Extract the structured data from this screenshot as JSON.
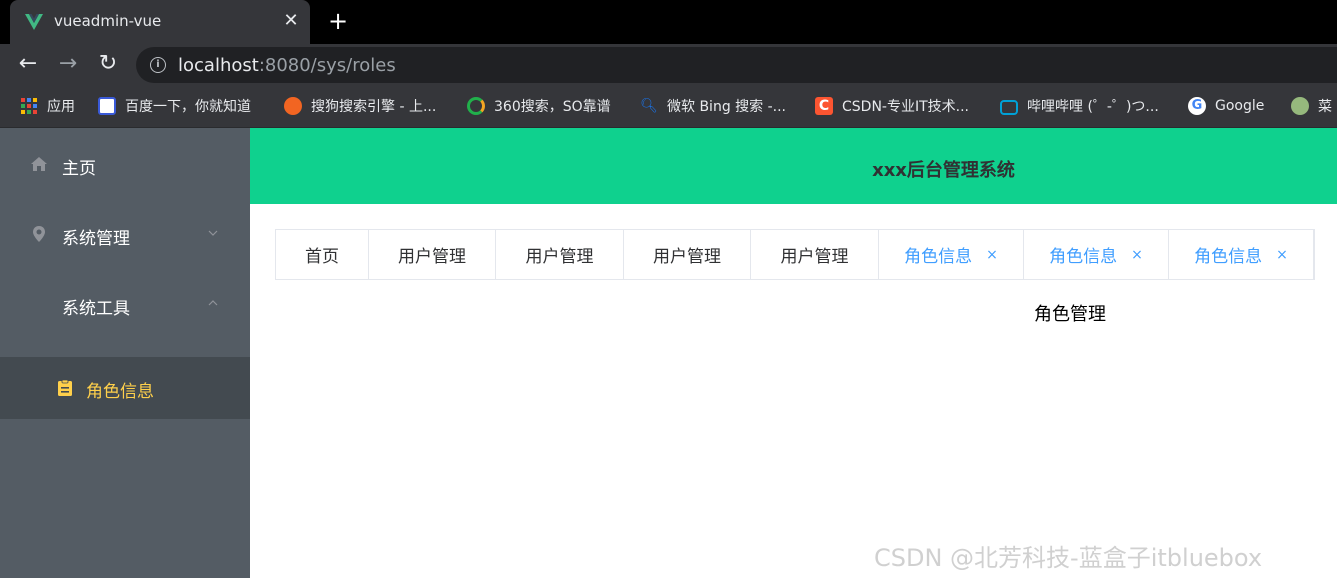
{
  "browser": {
    "tab_title": "vueadmin-vue",
    "url_host": "localhost",
    "url_rest": ":8080/sys/roles",
    "bookmarks": [
      {
        "label": "应用",
        "icon": "apps-grid-icon",
        "color": "#ea4335"
      },
      {
        "label": "百度一下，你就知道",
        "icon": "baidu-icon",
        "color": "#3a5ad8"
      },
      {
        "label": "搜狗搜索引擎 - 上...",
        "icon": "sogou-icon",
        "color": "#f26522"
      },
      {
        "label": "360搜索，SO靠谱",
        "icon": "360-search-icon",
        "color": "#21b04b"
      },
      {
        "label": "微软 Bing 搜索 -...",
        "icon": "bing-search-icon",
        "color": "#1a73e8"
      },
      {
        "label": "CSDN-专业IT技术...",
        "icon": "csdn-icon",
        "color": "#fc5531"
      },
      {
        "label": "哔哩哔哩 (゜-゜)つ...",
        "icon": "bilibili-icon",
        "color": "#00a1d6"
      },
      {
        "label": "Google",
        "icon": "google-icon",
        "color": "#4285f4"
      },
      {
        "label": "菜",
        "icon": "runoob-icon",
        "color": "#96b97d"
      }
    ]
  },
  "sidebar": {
    "items": [
      {
        "label": "主页",
        "icon": "home-icon"
      },
      {
        "label": "系统管理",
        "icon": "location-icon",
        "arrow": "chevron-down-icon"
      },
      {
        "label": "系统工具",
        "arrow": "chevron-up-icon"
      }
    ],
    "active_submenu": {
      "label": "角色信息",
      "icon": "document-icon"
    }
  },
  "header": {
    "title": "xxx后台管理系统"
  },
  "tabs": [
    {
      "label": "首页",
      "closable": false,
      "active": false
    },
    {
      "label": "用户管理",
      "closable": false,
      "active": false
    },
    {
      "label": "用户管理",
      "closable": false,
      "active": false
    },
    {
      "label": "用户管理",
      "closable": false,
      "active": false
    },
    {
      "label": "用户管理",
      "closable": false,
      "active": false
    },
    {
      "label": "角色信息",
      "closable": true,
      "active": true
    },
    {
      "label": "角色信息",
      "closable": true,
      "active": true
    },
    {
      "label": "角色信息",
      "closable": true,
      "active": true
    }
  ],
  "tab_close_glyph": "×",
  "main": {
    "content": "角色管理"
  },
  "watermark": "CSDN @北芳科技-蓝盒子itbluebox",
  "colors": {
    "header_bg": "#0fd18e",
    "sidebar_bg": "#545c64",
    "sidebar_active_bg": "#434a50",
    "sidebar_active_text": "#ffd04b",
    "active_tab_text": "#409eff"
  }
}
